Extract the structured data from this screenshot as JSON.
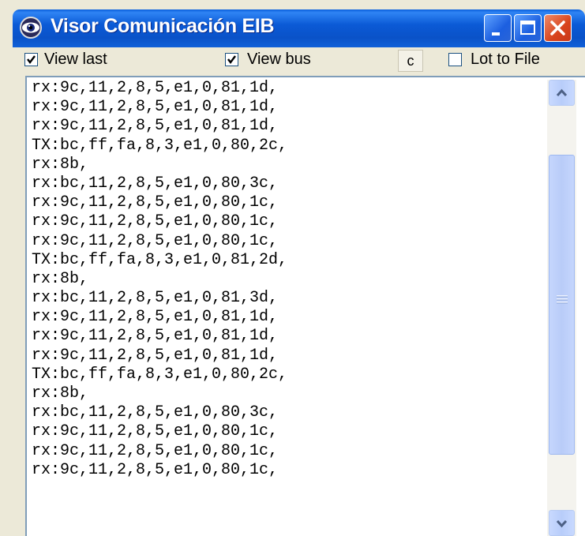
{
  "window": {
    "title": "Visor Comunicación EIB",
    "icon": "eye-icon",
    "buttons": [
      "minimize-icon",
      "maximize-icon",
      "close-icon"
    ]
  },
  "toolbar": {
    "view_last": {
      "label": "View last",
      "checked": true
    },
    "view_bus": {
      "label": "View bus",
      "checked": true
    },
    "clear_label": "c",
    "log_to_file": {
      "label": "Lot to File",
      "checked": false
    }
  },
  "log": {
    "lines": [
      "rx:9c,11,2,8,5,e1,0,81,1d,",
      "rx:9c,11,2,8,5,e1,0,81,1d,",
      "rx:9c,11,2,8,5,e1,0,81,1d,",
      "TX:bc,ff,fa,8,3,e1,0,80,2c,",
      "rx:8b,",
      "rx:bc,11,2,8,5,e1,0,80,3c,",
      "rx:9c,11,2,8,5,e1,0,80,1c,",
      "rx:9c,11,2,8,5,e1,0,80,1c,",
      "rx:9c,11,2,8,5,e1,0,80,1c,",
      "TX:bc,ff,fa,8,3,e1,0,81,2d,",
      "rx:8b,",
      "rx:bc,11,2,8,5,e1,0,81,3d,",
      "rx:9c,11,2,8,5,e1,0,81,1d,",
      "rx:9c,11,2,8,5,e1,0,81,1d,",
      "rx:9c,11,2,8,5,e1,0,81,1d,",
      "TX:bc,ff,fa,8,3,e1,0,80,2c,",
      "rx:8b,",
      "rx:bc,11,2,8,5,e1,0,80,3c,",
      "rx:9c,11,2,8,5,e1,0,80,1c,",
      "rx:9c,11,2,8,5,e1,0,80,1c,",
      "rx:9c,11,2,8,5,e1,0,80,1c,"
    ]
  },
  "colors": {
    "titlebar": "#0a52c8",
    "close_button": "#d8431c",
    "window_face": "#ece9d8"
  }
}
